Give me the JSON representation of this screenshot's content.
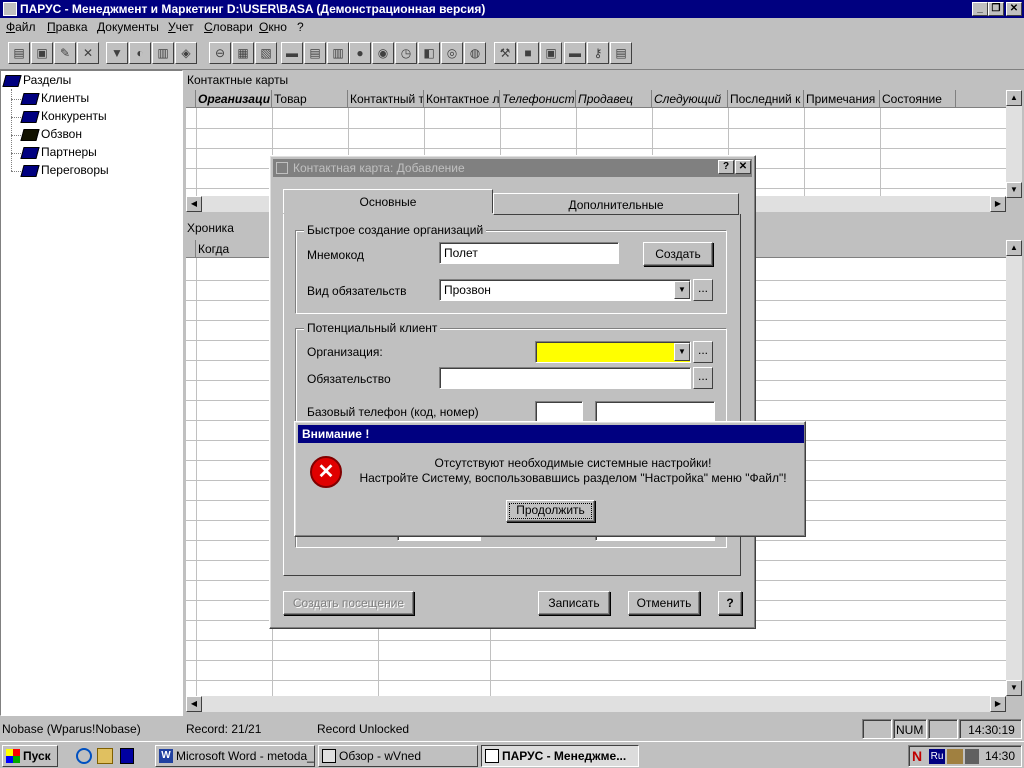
{
  "window": {
    "title": "ПАРУС - Менеджмент и Маркетинг  D:\\USER\\BASA (Демонстрационная версия)",
    "controls": [
      "_",
      "❐",
      "✕"
    ]
  },
  "menu": [
    "Файл",
    "Правка",
    "Документы",
    "Учет",
    "Словари",
    "Окно",
    "?"
  ],
  "tree": {
    "root": "Разделы",
    "items": [
      "Клиенты",
      "Конкуренты",
      "Обзвон",
      "Партнеры",
      "Переговоры"
    ]
  },
  "contacts_panel": {
    "label": "Контактные карты",
    "columns": [
      "Организаци",
      "Товар",
      "Контактный т",
      "Контактное л",
      "Телефонист",
      "Продавец",
      "Следующий",
      "Последний к",
      "Примечания",
      "Состояние"
    ]
  },
  "chronicle_panel": {
    "label": "Хроника",
    "columns": [
      "Когда"
    ]
  },
  "dialog": {
    "title": "Контактная карта: Добавление",
    "help_btn": "?",
    "close_btn": "✕",
    "tabs": [
      "Основные",
      "Дополнительные"
    ],
    "quick_group": "Быстрое создание организаций",
    "mnemo_label": "Мнемокод",
    "mnemo_value": "Полет",
    "create_btn": "Создать",
    "obligation_type_label": "Вид обязательств",
    "obligation_type_value": "Прозвон",
    "potential_group": "Потенциальный клиент",
    "org_label": "Организация:",
    "obligation_label": "Обязательство",
    "phone_label": "Базовый телефон (код, номер)",
    "create_visit_btn": "Создать посещение",
    "save_btn": "Записать",
    "cancel_btn": "Отменить",
    "q_btn": "?",
    "ellipsis": "...",
    "combo_arrow": "▼",
    "org_highlight_color": "#ffff00"
  },
  "alert": {
    "title": "Внимание !",
    "line1": "Отсутствуют необходимые системные настройки!",
    "line2": "Настройте Систему, воспользовавшись разделом \"Настройка\" меню \"Файл\"!",
    "continue_btn": "Продолжить",
    "icon_glyph": "✕"
  },
  "status": {
    "db": "Nobase (Wparus!Nobase)",
    "record": "Record: 21/21",
    "lock": "Record Unlocked",
    "num": "NUM",
    "time": "14:30:19"
  },
  "taskbar": {
    "start": "Пуск",
    "tasks": [
      "Microsoft Word - metoda_...",
      "Обзор - wVned",
      "ПАРУС - Менеджме..."
    ],
    "tray_lang": "Ru",
    "tray_n": "N",
    "clock": "14:30"
  }
}
